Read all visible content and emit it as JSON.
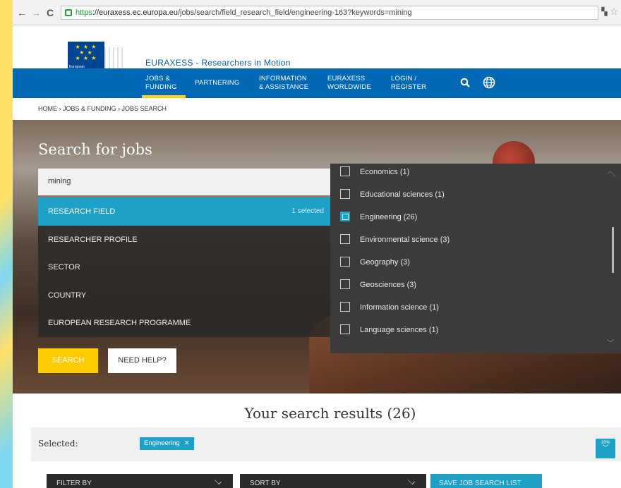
{
  "browser": {
    "url_scheme": "https",
    "url_host": "://euraxess.ec.europa.eu",
    "url_path": "/jobs/search/field_research_field/engineering-163?keywords=mining"
  },
  "header": {
    "logo_text": "European Commission",
    "site_title": "EURAXESS - Researchers in Motion"
  },
  "nav": {
    "items": [
      {
        "line1": "JOBS &",
        "line2": "FUNDING"
      },
      {
        "line1": "PARTNERING",
        "line2": ""
      },
      {
        "line1": "INFORMATION",
        "line2": "& ASSISTANCE"
      },
      {
        "line1": "EURAXESS",
        "line2": "WORLDWIDE"
      },
      {
        "line1": "LOGIN /",
        "line2": "REGISTER"
      }
    ],
    "icons": [
      "search-icon",
      "globe-icon"
    ]
  },
  "breadcrumb": "HOME › JOBS & FUNDING › JOBS SEARCH",
  "search": {
    "title": "Search for jobs",
    "keyword": "mining",
    "facets": [
      {
        "label": "RESEARCH FIELD",
        "sub": "1 selected"
      },
      {
        "label": "RESEARCHER PROFILE",
        "sub": ""
      },
      {
        "label": "SECTOR",
        "sub": ""
      },
      {
        "label": "COUNTRY",
        "sub": ""
      },
      {
        "label": "EUROPEAN RESEARCH PROGRAMME",
        "sub": ""
      }
    ],
    "search_button": "SEARCH",
    "help_button": "NEED HELP?"
  },
  "dropdown": {
    "items": [
      {
        "label": "Economics (1)",
        "checked": false
      },
      {
        "label": "Educational sciences (1)",
        "checked": false
      },
      {
        "label": "Engineering (26)",
        "checked": true
      },
      {
        "label": "Environmental science (3)",
        "checked": false
      },
      {
        "label": "Geography (3)",
        "checked": false
      },
      {
        "label": "Geosciences (3)",
        "checked": false
      },
      {
        "label": "Information science (1)",
        "checked": false
      },
      {
        "label": "Language sciences (1)",
        "checked": false
      }
    ]
  },
  "results": {
    "title": "Your search results (26)",
    "selected_label": "Selected:",
    "chip": "Engineering",
    "pct": "20%"
  },
  "bottom": {
    "filter_by": "FILTER BY",
    "sort_by": "SORT BY",
    "save": "SAVE JOB SEARCH LIST"
  },
  "colors": {
    "nav_blue": "#0068b4",
    "accent_cyan": "#1fa1c7",
    "accent_yellow": "#ffcc00"
  }
}
